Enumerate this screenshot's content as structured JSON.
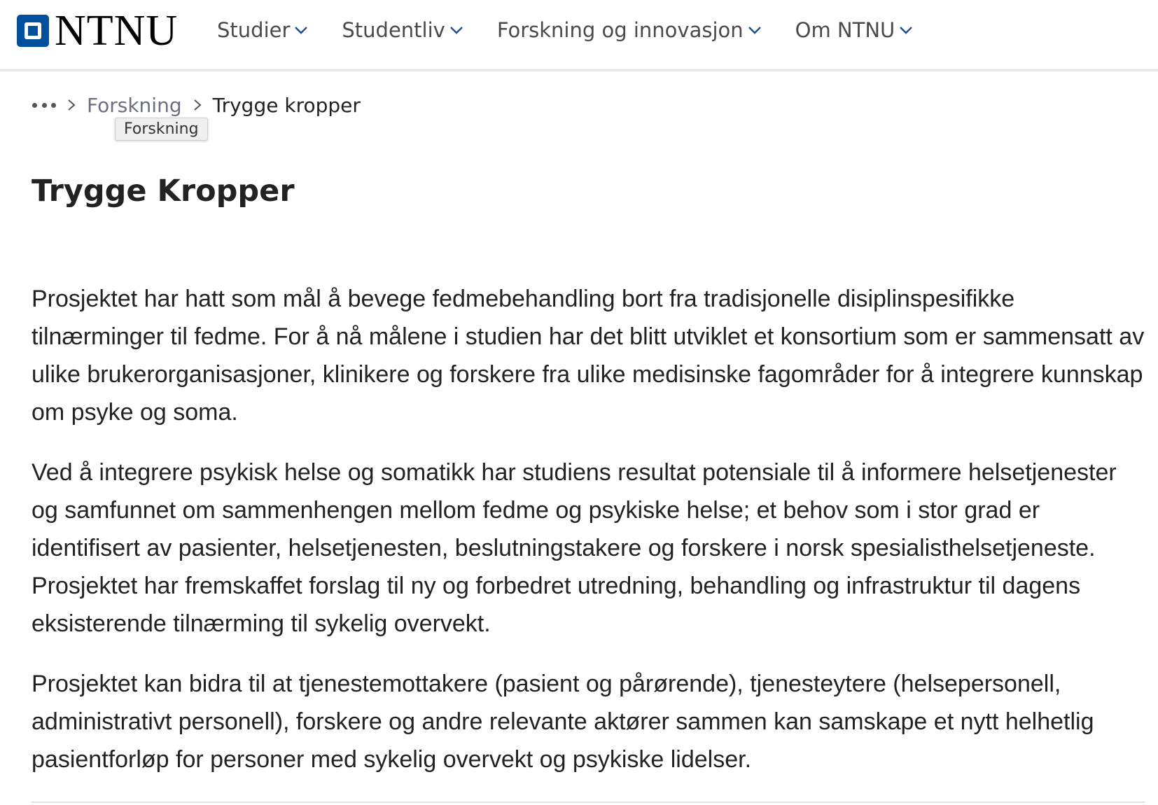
{
  "header": {
    "logo_text": "NTNU",
    "nav": [
      {
        "label": "Studier"
      },
      {
        "label": "Studentliv"
      },
      {
        "label": "Forskning og innovasjon"
      },
      {
        "label": "Om NTNU"
      }
    ]
  },
  "breadcrumb": {
    "more_icon": "ellipsis-icon",
    "separator_icon": "chevron-right-icon",
    "items": [
      {
        "label": "Forskning"
      },
      {
        "label": "Trygge kropper"
      }
    ],
    "tooltip": "Forskning"
  },
  "page": {
    "title": "Trygge Kropper",
    "paragraphs": [
      "Prosjektet har hatt som mål å bevege fedmebehandling bort fra tradisjonelle disiplinspesifikke tilnærminger til fedme. For å nå målene i studien har det blitt utviklet et konsortium som er sammensatt av ulike brukerorganisasjoner, klinikere og forskere fra ulike medisinske fagområder for å integrere kunnskap om psyke og soma.",
      "Ved å integrere psykisk helse og somatikk har studiens resultat potensiale til å informere helsetjenester og samfunnet om sammenhengen mellom fedme og psykiske helse; et behov som i stor grad er identifisert av pasienter, helsetjenesten, beslutningstakere og forskere i norsk spesialisthelsetjeneste. Prosjektet har fremskaffet forslag til ny og forbedret utredning, behandling og infrastruktur til dagens eksisterende tilnærming til sykelig overvekt.",
      "Prosjektet kan bidra til at tjenestemottakere (pasient og pårørende), tjenesteytere (helsepersonell, administrativt personell), forskere og andre relevante aktører sammen kan samskape et nytt helhetlig pasientforløp for personer med sykelig overvekt og psykiske lidelser."
    ]
  },
  "colors": {
    "brand_blue": "#00509e",
    "nav_text": "#4a4a4a",
    "breadcrumb_link": "#6b6f80"
  }
}
